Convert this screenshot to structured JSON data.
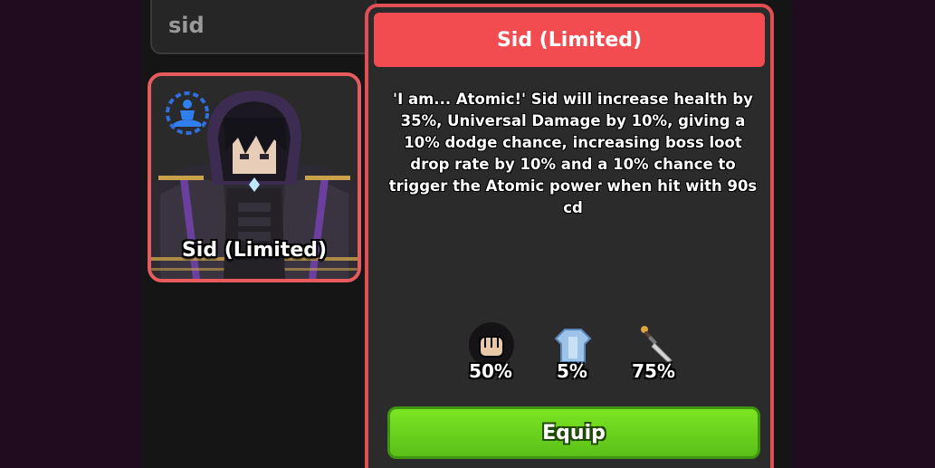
{
  "search": {
    "value": "sid"
  },
  "card": {
    "name": "Sid (Limited)",
    "type_icon": "meditation-icon"
  },
  "panel": {
    "title": "Sid (Limited)",
    "description": "'I am... Atomic!' Sid will increase health by 35%, Universal Damage by 10%, giving a 10% dodge chance, increasing boss loot drop rate by 10% and a 10% chance to trigger the Atomic power when hit with 90s cd",
    "stats": [
      {
        "icon": "fist-icon",
        "value": "50%"
      },
      {
        "icon": "armor-icon",
        "value": "5%"
      },
      {
        "icon": "dagger-icon",
        "value": "75%"
      }
    ],
    "equip_label": "Equip"
  },
  "colors": {
    "accent": "#f24c50",
    "equip": "#6bd41e",
    "background": "#210c1f"
  }
}
